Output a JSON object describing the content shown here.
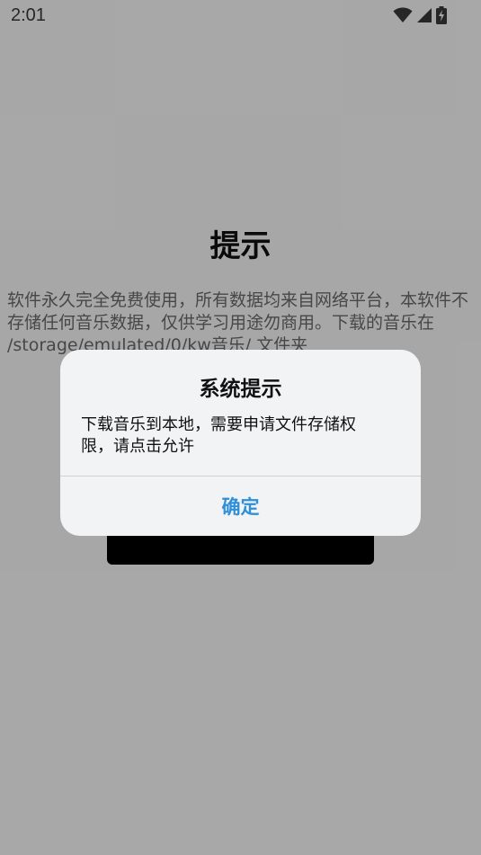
{
  "status_bar": {
    "time": "2:01",
    "icons": [
      "wifi-icon",
      "cellular-signal-icon",
      "battery-charging-icon"
    ]
  },
  "page": {
    "title": "提示",
    "notice": "软件永久完全免费使用，所有数据均来自网络平台，本软件不存储任何音乐数据，仅供学习用途勿商用。下载的音乐在 /storage/emulated/0/kw音乐/ 文件夹"
  },
  "dialog": {
    "title": "系统提示",
    "message": "下载音乐到本地，需要申请文件存储权限，请点击允许",
    "confirm_label": "确定"
  },
  "colors": {
    "accent": "#2f8fd8",
    "scrim": "rgba(0,0,0,0.33)",
    "dialog_background": "#f2f3f5"
  }
}
